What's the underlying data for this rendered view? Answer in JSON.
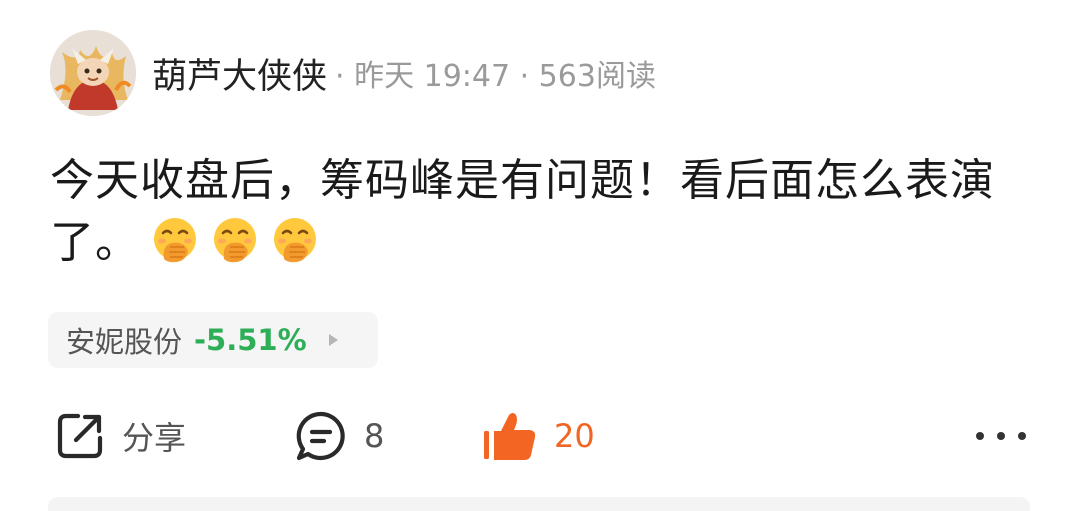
{
  "post": {
    "username": "葫芦大侠侠",
    "meta": "· 昨天 19:47 · 563阅读",
    "text": "今天收盘后，筹码峰是有问题！看后面怎么表演了。"
  },
  "stock_tag": {
    "name": "安妮股份",
    "change": "-5.51%",
    "change_color": "#2eae57"
  },
  "actions": {
    "share_label": "分享",
    "comment_count": "8",
    "like_count": "20",
    "like_color": "#f26522"
  },
  "icons": {
    "avatar": "avatar-image",
    "emoji": "hand-over-mouth-emoji",
    "share": "share-icon",
    "comment": "comment-icon",
    "like": "thumbs-up-icon",
    "more": "more-icon"
  }
}
